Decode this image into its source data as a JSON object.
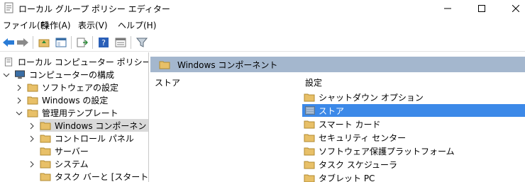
{
  "window": {
    "title": "ローカル グループ ポリシー エディター"
  },
  "menu": {
    "items": [
      "ファイル(F)",
      "操作(A)",
      "表示(V)",
      "ヘルプ(H)"
    ]
  },
  "tree": {
    "items": [
      {
        "label": "ローカル コンピューター ポリシー"
      },
      {
        "label": "コンピューターの構成"
      },
      {
        "label": "ソフトウェアの設定"
      },
      {
        "label": "Windows の設定"
      },
      {
        "label": "管理用テンプレート"
      },
      {
        "label": "Windows コンポーネント"
      },
      {
        "label": "コントロール パネル"
      },
      {
        "label": "サーバー"
      },
      {
        "label": "システム"
      },
      {
        "label": "タスク バーと [スタート] メニュー"
      }
    ]
  },
  "right": {
    "header_title": "Windows コンポーネント",
    "description_title": "ストア",
    "column_header": "設定",
    "items": [
      {
        "label": "シャットダウン オプション"
      },
      {
        "label": "ストア"
      },
      {
        "label": "スマート カード"
      },
      {
        "label": "セキュリティ センター"
      },
      {
        "label": "ソフトウェア保護プラットフォーム"
      },
      {
        "label": "タスク スケジューラ"
      },
      {
        "label": "タブレット PC"
      }
    ]
  },
  "colors": {
    "header_band": "#a4b7ce",
    "selection": "#3c89e8",
    "tree_selection": "#d9d9d9",
    "folder": "#e8c068"
  }
}
